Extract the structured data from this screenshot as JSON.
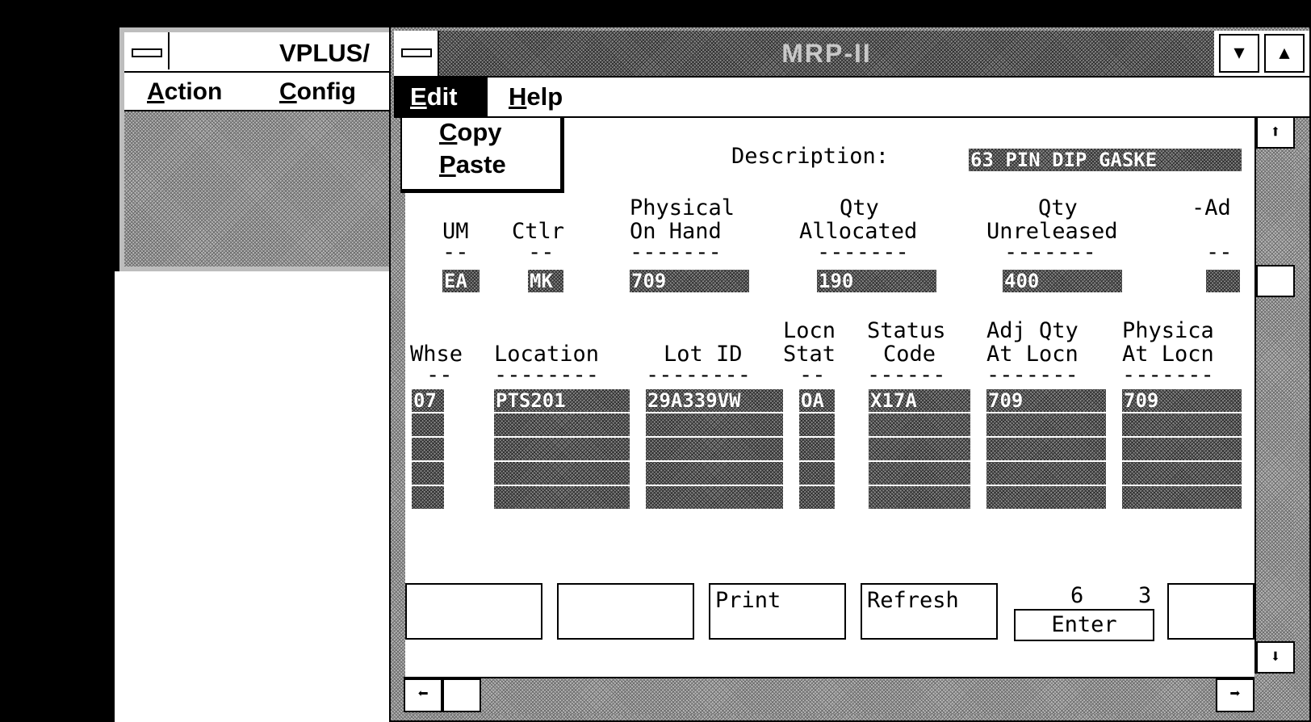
{
  "bg_window": {
    "title": "VPLUS/",
    "menu": [
      {
        "mnemonic": "A",
        "rest": "ction"
      },
      {
        "mnemonic": "C",
        "rest": "onfig"
      }
    ]
  },
  "main_window": {
    "title": "MRP-II",
    "minimize_glyph": "▼",
    "maximize_glyph": "▲",
    "menu": {
      "edit": {
        "mnemonic": "E",
        "rest": "dit"
      },
      "help": {
        "mnemonic": "H",
        "rest": "elp"
      }
    },
    "dropdown": [
      {
        "mnemonic": "C",
        "rest": "opy"
      },
      {
        "mnemonic": "P",
        "rest": "aste"
      }
    ]
  },
  "form": {
    "description_label": "Description:",
    "description_value": "63 PIN DIP GASKE",
    "top_headers": {
      "um": [
        "",
        "UM",
        "--"
      ],
      "ctlr": [
        "",
        "Ctlr",
        "--"
      ],
      "physical": [
        "Physical",
        "On Hand",
        "-------"
      ],
      "allocated": [
        "Qty",
        "Allocated",
        "-------"
      ],
      "unreleased": [
        "Qty",
        "Unreleased",
        "-------"
      ],
      "adj": [
        "-Ad",
        "",
        "--"
      ]
    },
    "top_values": {
      "um": "EA",
      "ctlr": "MK",
      "physical": "709",
      "allocated": "190",
      "unreleased": "400",
      "adj": ""
    },
    "grid_headers": {
      "whse": [
        "",
        "Whse",
        "--"
      ],
      "location": [
        "",
        "Location",
        "--------"
      ],
      "lot": [
        "",
        "Lot ID",
        "--------"
      ],
      "locn_stat": [
        "Locn",
        "Stat",
        "--"
      ],
      "status_code": [
        "Status",
        "Code",
        "------"
      ],
      "adj_qty": [
        "Adj Qty",
        "At Locn",
        "-------"
      ],
      "physical_locn": [
        "Physica",
        "At Locn",
        "-------"
      ]
    },
    "grid_rows": [
      {
        "whse": "07",
        "location": "PTS201",
        "lot": "29A339VW",
        "locn_stat": "OA",
        "status_code": "X17A",
        "adj_qty": "709",
        "physical_locn": "709"
      },
      {
        "whse": "",
        "location": "",
        "lot": "",
        "locn_stat": "",
        "status_code": "",
        "adj_qty": "",
        "physical_locn": ""
      },
      {
        "whse": "",
        "location": "",
        "lot": "",
        "locn_stat": "",
        "status_code": "",
        "adj_qty": "",
        "physical_locn": ""
      },
      {
        "whse": "",
        "location": "",
        "lot": "",
        "locn_stat": "",
        "status_code": "",
        "adj_qty": "",
        "physical_locn": ""
      },
      {
        "whse": "",
        "location": "",
        "lot": "",
        "locn_stat": "",
        "status_code": "",
        "adj_qty": "",
        "physical_locn": ""
      }
    ]
  },
  "function_keys": {
    "f1": "",
    "f2": "",
    "print": "Print",
    "refresh": "Refresh",
    "enter_top_left": "6",
    "enter_top_right": "3",
    "enter": "Enter",
    "f6": ""
  },
  "scroll": {
    "up": "⬆",
    "down": "⬇",
    "left": "⬅",
    "right": "➡"
  }
}
